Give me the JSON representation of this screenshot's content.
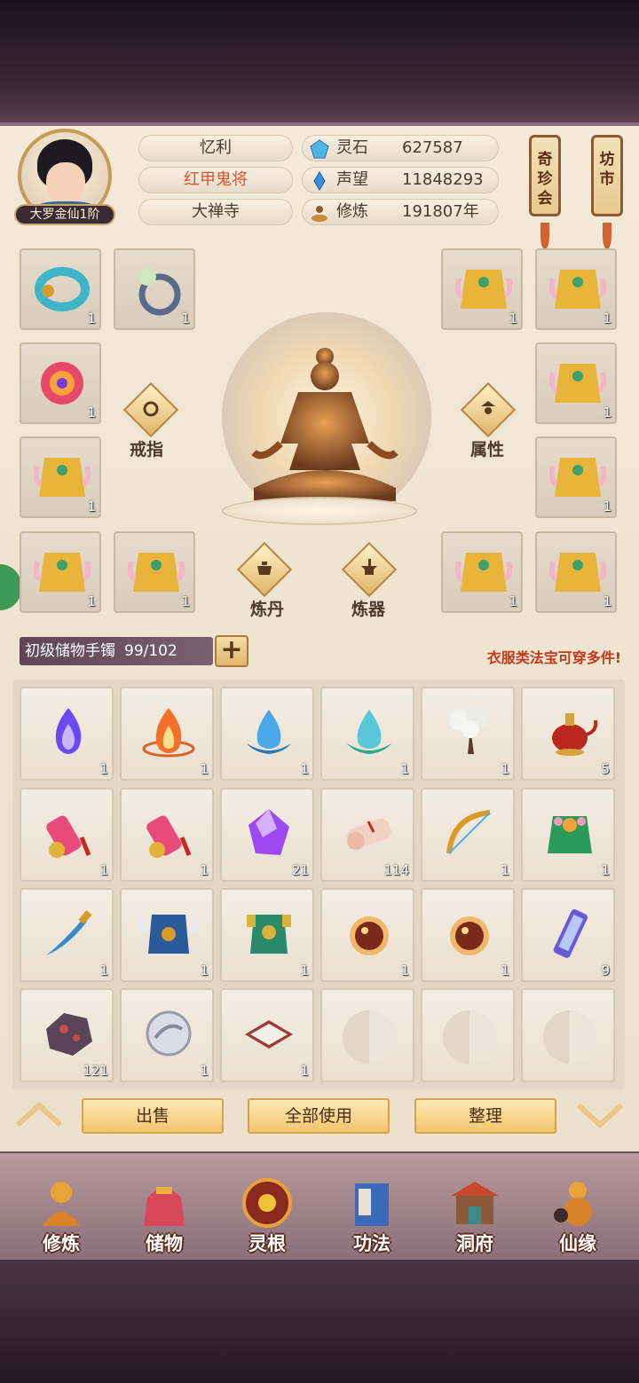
{
  "player": {
    "rank": "大罗金仙1阶",
    "name": "忆利",
    "title": "红甲鬼将",
    "sect": "大禅寺"
  },
  "stats": [
    {
      "label": "灵石",
      "value": "627587",
      "icon": "spirit-stone-icon"
    },
    {
      "label": "声望",
      "value": "11848293",
      "icon": "reputation-icon"
    },
    {
      "label": "修炼",
      "value": "191807年",
      "icon": "cultivation-icon"
    }
  ],
  "header_buttons": {
    "treasure_hall": "奇珍会",
    "market": "坊市"
  },
  "equipment": {
    "counts": [
      "1",
      "1",
      "1",
      "1",
      "1",
      "1",
      "1",
      "1",
      "1",
      "1",
      "1",
      "1",
      "1"
    ],
    "ring_label": "戒指",
    "attribute_label": "属性",
    "alchemy_label": "炼丹",
    "forge_label": "炼器"
  },
  "bag": {
    "name": "初级储物手镯",
    "capacity": "99/102",
    "hint": "衣服类法宝可穿多件!",
    "plus": "+"
  },
  "inventory": [
    {
      "item": "purple-flame",
      "count": "1"
    },
    {
      "item": "fire-flame",
      "count": "1"
    },
    {
      "item": "blue-water-orb",
      "count": "1"
    },
    {
      "item": "green-water-orb",
      "count": "1"
    },
    {
      "item": "white-blossom-tree",
      "count": "1"
    },
    {
      "item": "red-teapot",
      "count": "5"
    },
    {
      "item": "golden-scroll",
      "count": "1"
    },
    {
      "item": "golden-scroll",
      "count": "1"
    },
    {
      "item": "purple-crystal",
      "count": "21"
    },
    {
      "item": "paper-scroll",
      "count": "114"
    },
    {
      "item": "golden-bow",
      "count": "1"
    },
    {
      "item": "green-flower-robe",
      "count": "1"
    },
    {
      "item": "blue-dagger",
      "count": "1"
    },
    {
      "item": "blue-armor",
      "count": "1"
    },
    {
      "item": "green-armor",
      "count": "1"
    },
    {
      "item": "fire-pearl",
      "count": "1"
    },
    {
      "item": "fire-pearl",
      "count": "1"
    },
    {
      "item": "purple-talisman",
      "count": "9"
    },
    {
      "item": "dark-ore",
      "count": "121"
    },
    {
      "item": "silver-disc",
      "count": "1"
    },
    {
      "item": "rice-box",
      "count": "1"
    },
    {
      "item": "empty",
      "count": ""
    },
    {
      "item": "empty",
      "count": ""
    },
    {
      "item": "empty",
      "count": ""
    }
  ],
  "actions": {
    "sell": "出售",
    "use_all": "全部使用",
    "sort": "整理"
  },
  "nav": [
    {
      "label": "修炼",
      "icon": "cultivate-icon"
    },
    {
      "label": "储物",
      "icon": "storage-bag-icon"
    },
    {
      "label": "灵根",
      "icon": "spirit-root-icon"
    },
    {
      "label": "功法",
      "icon": "technique-book-icon"
    },
    {
      "label": "洞府",
      "icon": "cave-palace-icon"
    },
    {
      "label": "仙缘",
      "icon": "immortal-gourd-icon"
    }
  ]
}
